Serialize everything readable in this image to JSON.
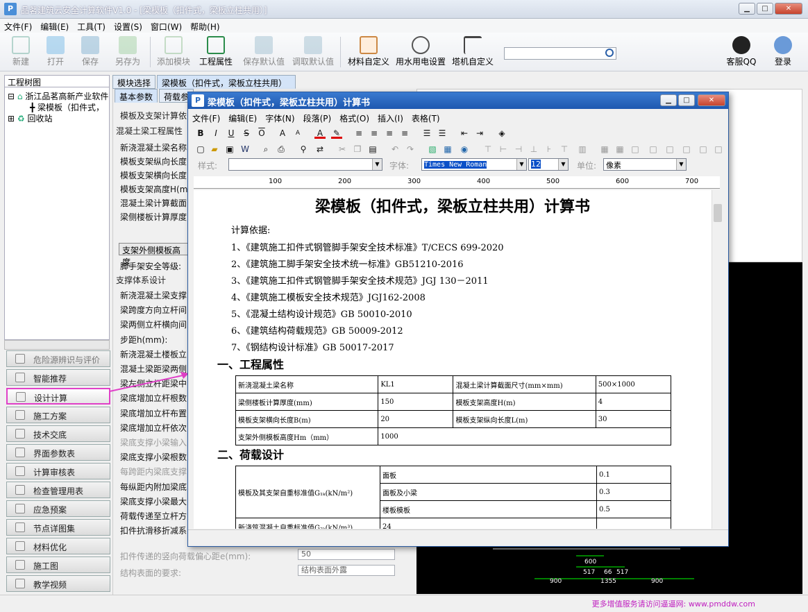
{
  "app": {
    "title": "品茗建筑云安全计算软件V1.0 - [梁模板（扣件式，梁板立柱共用）]"
  },
  "menu": [
    "文件(F)",
    "编辑(E)",
    "工具(T)",
    "设置(S)",
    "窗口(W)",
    "帮助(H)"
  ],
  "toolbar": {
    "new": "新建",
    "open": "打开",
    "save": "保存",
    "saveas": "另存为",
    "add_module": "添加模块",
    "project_props": "工程属性",
    "save_default": "保存默认值",
    "load_default": "调取默认值",
    "material": "材料自定义",
    "water_elec": "用水用电设置",
    "crane": "塔机自定义",
    "qq": "客服QQ",
    "login": "登录"
  },
  "tree": {
    "header": "工程树图",
    "root": "浙江品茗高新产业软件",
    "child": "梁模板（扣件式，",
    "recycle": "回收站"
  },
  "nav": [
    "危险源辨识与评价",
    "智能推荐",
    "设计计算",
    "施工方案",
    "技术交底",
    "界面参数表",
    "计算审核表",
    "检查管理用表",
    "应急预案",
    "节点详图集",
    "材料优化",
    "施工图",
    "教学视频"
  ],
  "panel": {
    "tab_module": "模块选择",
    "tab_beam": "梁模板（扣件式，梁板立柱共用）",
    "tab_basic": "基本参数",
    "tab_load": "荷载参",
    "rows_top": [
      "模板及支架计算依",
      "混凝土梁工程属性",
      "新浇混凝土梁名称",
      "模板支架纵向长度",
      "模板支架横向长度",
      "模板支架高度H(m)",
      "混凝土梁计算截面",
      "梁侧楼板计算厚度"
    ],
    "btn_outer": "支架外侧模板高度",
    "safety": "脚手架安全等级:",
    "support": "支撑体系设计",
    "rows_mid": [
      "新浇混凝土梁支撑",
      "梁跨度方向立杆间",
      "梁两侧立杆横向间",
      "步距h(mm):",
      "新浇混凝土楼板立",
      "混凝土梁距梁两侧",
      "梁左侧立杆距梁中",
      "梁底增加立杆根数",
      "梁底增加立杆布置",
      "梁底增加立杆依次",
      "梁底支撑小梁输入",
      "梁底支撑小梁根数",
      "每跨距内梁底支撑",
      "每纵距内附加梁底",
      "梁底支撑小梁最大",
      "荷载传递至立杆方",
      "扣件抗滑移折减系"
    ],
    "ecc_label": "扣件传递的竖向荷载偏心距e(mm):",
    "ecc_value": "50",
    "surface_label": "结构表面的要求:",
    "surface_value": "结构表面外露"
  },
  "status": "更多增值服务请访问逼逼网: www.pmddw.com",
  "dialog": {
    "title": "梁模板（扣件式，梁板立柱共用）计算书",
    "menu": [
      "文件(F)",
      "编辑(E)",
      "字体(N)",
      "段落(P)",
      "格式(O)",
      "插入(I)",
      "表格(T)"
    ],
    "style_label": "样式:",
    "font_label": "字体:",
    "font_value": "Times New Roman",
    "size_value": "12",
    "unit_label": "单位:",
    "unit_value": "像素",
    "ruler": [
      "100",
      "200",
      "300",
      "400",
      "500",
      "600",
      "700"
    ],
    "doc_title": "梁模板（扣件式，梁板立柱共用）计算书",
    "basis": "计算依据:",
    "refs": [
      "1、《建筑施工扣件式钢管脚手架安全技术标准》T/CECS 699-2020",
      "2、《建筑施工脚手架安全技术统一标准》GB51210-2016",
      "3、《建筑施工扣件式钢管脚手架安全技术规范》JGJ 130－2011",
      "4、《建筑施工模板安全技术规范》JGJ162-2008",
      "5、《混凝土结构设计规范》GB 50010-2010",
      "6、《建筑结构荷载规范》GB 50009-2012",
      "7、《钢结构设计标准》GB 50017-2017"
    ],
    "h1": "一、工程属性",
    "t1": [
      [
        "新浇混凝土梁名称",
        "KL1",
        "混凝土梁计算截面尺寸(mm×mm)",
        "500×1000"
      ],
      [
        "梁侧楼板计算厚度(mm)",
        "150",
        "模板支架高度H(m)",
        "4"
      ],
      [
        "模板支架横向长度B(m)",
        "20",
        "模板支架纵向长度L(m)",
        "30"
      ],
      [
        "支架外侧模板高度Hm（mm）",
        "1000",
        "",
        ""
      ]
    ],
    "h2": "二、荷载设计",
    "t2_label": "模板及其支架自重标准值G₁ₖ(kN/m²)",
    "t2": [
      [
        "面板",
        "0.1"
      ],
      [
        "面板及小梁",
        "0.3"
      ],
      [
        "楼板模板",
        "0.5"
      ]
    ],
    "t2_next_label": "新浇筑混凝土自重标准值G₂ₖ(kN/m³)",
    "t2_next_value": "24"
  },
  "drawing": {
    "dims": [
      "600",
      "517",
      "66",
      "517",
      "900",
      "1355",
      "900"
    ]
  }
}
